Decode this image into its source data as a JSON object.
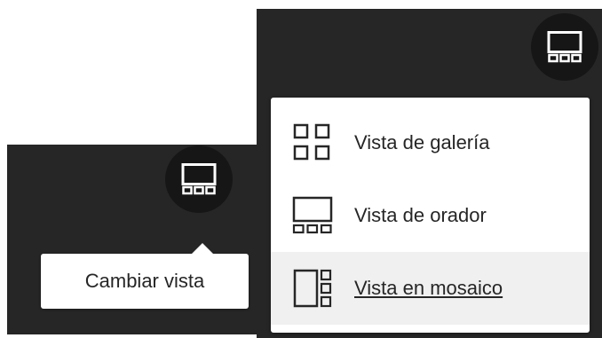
{
  "left_panel": {
    "view_button_icon": "speaker-view-icon",
    "tooltip_text": "Cambiar vista"
  },
  "right_panel": {
    "view_button_icon": "speaker-view-icon",
    "menu": {
      "items": [
        {
          "label": "Vista de galería",
          "icon": "gallery-view-icon"
        },
        {
          "label": "Vista de orador",
          "icon": "speaker-view-icon"
        },
        {
          "label": "Vista en mosaico",
          "icon": "tile-view-icon",
          "active": true
        }
      ]
    }
  },
  "colors": {
    "panel_background": "#262626",
    "button_background": "#161616",
    "icon_light": "#ffffff",
    "icon_dark": "#262626",
    "active_item_background": "#f0f0f0"
  }
}
